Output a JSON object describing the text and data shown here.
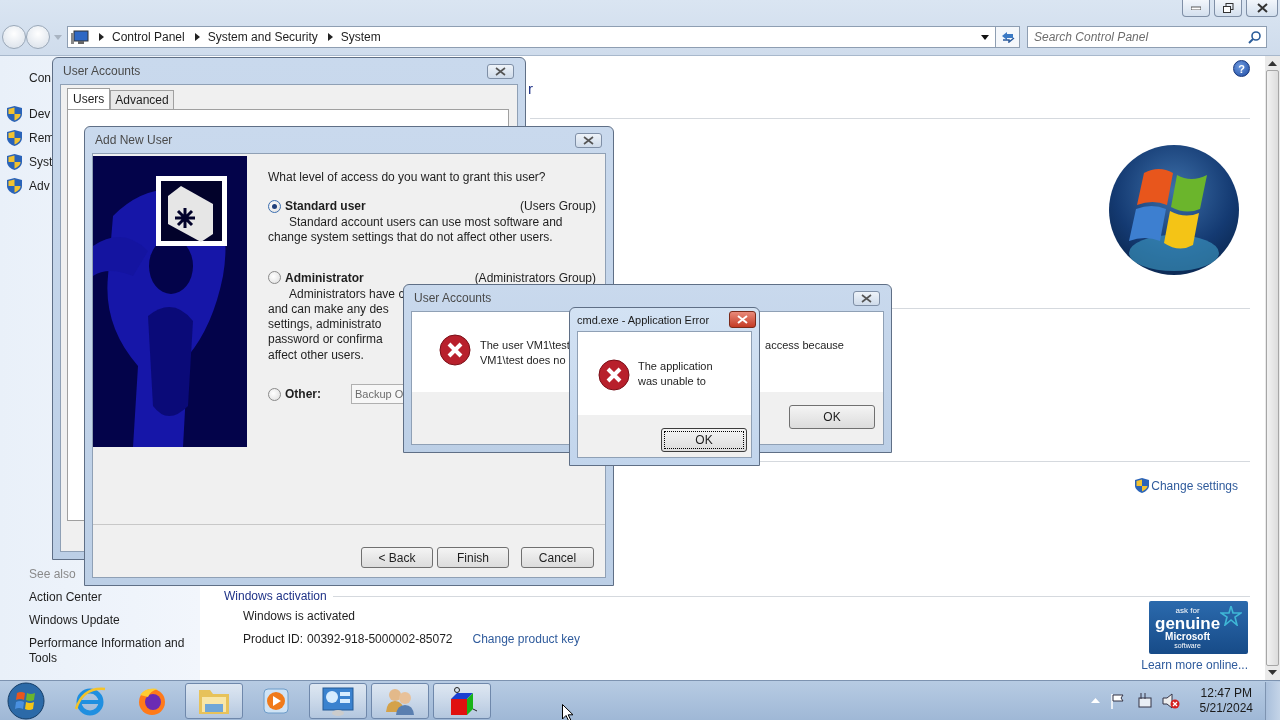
{
  "explorer": {
    "breadcrumb": [
      "Control Panel",
      "System and Security",
      "System"
    ],
    "search": {
      "placeholder": "Search Control Panel"
    },
    "help": "?",
    "sidebar": {
      "home": "Con",
      "tasks": [
        "Dev",
        "Rem",
        "Syst",
        "Adv"
      ],
      "see_also_title": "See also",
      "see_also": [
        "Action Center",
        "Windows Update",
        "Performance Information and Tools"
      ]
    },
    "heading_fragment": "r",
    "change_settings": "Change settings",
    "activation": {
      "title": "Windows activation",
      "status": "Windows is activated",
      "product_id_label": "Product ID:",
      "product_id": "00392-918-5000002-85072",
      "change_key": "Change product key",
      "badge": [
        "ask for",
        "genuine",
        "Microsoft",
        "software"
      ],
      "learn_more": "Learn more online..."
    }
  },
  "user_accounts": {
    "title": "User Accounts",
    "tabs": [
      {
        "label": "Users",
        "selected": true
      },
      {
        "label": "Advanced",
        "selected": false
      }
    ]
  },
  "add_new_user": {
    "title": "Add New User",
    "question": "What level of access do you want to grant this user?",
    "options": [
      {
        "kind": "described",
        "label": "Standard user",
        "group": "(Users Group)",
        "selected": true,
        "description": [
          "Standard account users can use most software and",
          "change system settings that do not affect other users."
        ]
      },
      {
        "kind": "described",
        "label": "Administrator",
        "group": "(Administrators Group)",
        "selected": false,
        "description": [
          "Administrators have c",
          "and can make any des",
          "settings, administrato",
          "password or confirma",
          "affect other users."
        ]
      },
      {
        "kind": "field",
        "label": "Other:",
        "selected": false,
        "value": "Backup O"
      }
    ],
    "buttons": [
      "< Back",
      "Finish",
      "Cancel"
    ]
  },
  "error_dialog": {
    "title": "User Accounts",
    "message_left": [
      "The user VM1\\test",
      "VM1\\test does no"
    ],
    "message_right": "access because",
    "button": "OK"
  },
  "app_error": {
    "title": "cmd.exe - Application Error",
    "message": [
      "The application",
      "was unable to"
    ],
    "button": "OK"
  },
  "taskbar": {
    "apps": [
      {
        "kind": "ie",
        "running": false
      },
      {
        "kind": "firefox",
        "running": false
      },
      {
        "kind": "folder",
        "running": true
      },
      {
        "kind": "media",
        "running": false
      },
      {
        "kind": "panel",
        "running": true
      },
      {
        "kind": "users",
        "running": true
      },
      {
        "kind": "cube",
        "running": true
      }
    ],
    "time": "12:47 PM",
    "date": "5/21/2024"
  }
}
